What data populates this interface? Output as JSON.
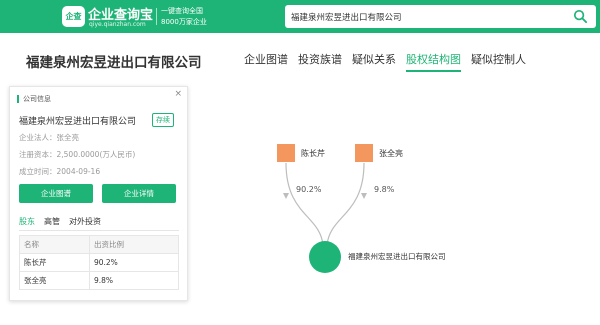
{
  "header": {
    "logo_glyph": "企查",
    "brand": "企业查询宝",
    "brand_url": "qiye.qianzhan.com",
    "slogan_line1": "一键查询全国",
    "slogan_line2": "8000万家企业",
    "search_value": "福建泉州宏昱进出口有限公司",
    "accent_color": "#1fb477"
  },
  "page": {
    "company_title": "福建泉州宏昱进出口有限公司",
    "tabs": [
      {
        "label": "企业图谱"
      },
      {
        "label": "投资族谱"
      },
      {
        "label": "疑似关系"
      },
      {
        "label": "股权结构图",
        "active": true
      },
      {
        "label": "疑似控制人"
      }
    ]
  },
  "card": {
    "close": "×",
    "heading": "公司信息",
    "company_name": "福建泉州宏昱进出口有限公司",
    "status": "存续",
    "legal_rep": "企业法人：张全亮",
    "capital": "注册资本：2,500.0000(万人民币)",
    "founded": "成立时间：2004-09-16",
    "btn_graph": "企业图谱",
    "btn_detail": "企业详情",
    "subtabs": [
      {
        "label": "股东",
        "active": true
      },
      {
        "label": "高管"
      },
      {
        "label": "对外投资"
      }
    ],
    "table": {
      "headers": [
        "名称",
        "出资比例"
      ],
      "rows": [
        [
          "陈长芹",
          "90.2%"
        ],
        [
          "张全亮",
          "9.8%"
        ]
      ]
    }
  },
  "graph": {
    "shareholders": [
      {
        "name": "陈长芹",
        "percent": "90.2%"
      },
      {
        "name": "张全亮",
        "percent": "9.8%"
      }
    ],
    "company_node_label": "福建泉州宏昱进出口有限公司",
    "person_color": "#f4975f",
    "company_color": "#1fb477",
    "line_color": "#bdbdbd"
  }
}
